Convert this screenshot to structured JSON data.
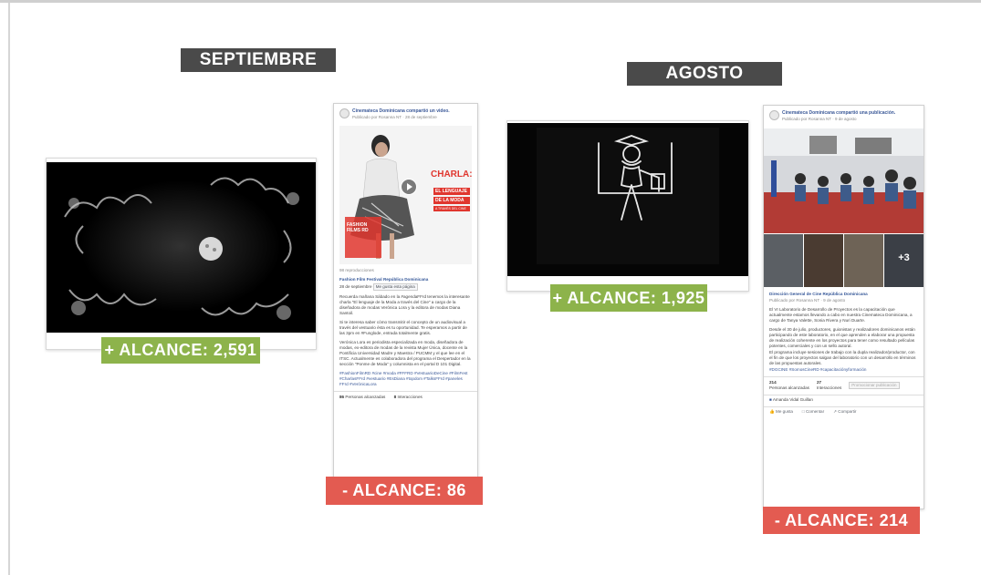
{
  "months": {
    "left": "SEPTIEMBRE",
    "right": "AGOSTO"
  },
  "badges": {
    "sept_video": "+  ALCANCE: 2,591",
    "sept_post": "- ALCANCE: 86",
    "ago_video": "+  ALCANCE: 1,925",
    "ago_post": "- ALCANCE: 214"
  },
  "colors": {
    "positive": "#8db34b",
    "negative": "#e35b51",
    "month_bar": "#4a4a4a"
  },
  "post_sept": {
    "header_line1": "Cinemateca Dominicana compartió un video.",
    "header_line2": "Publicado por Rosanna NT · 28 de septiembre",
    "poster_title": "CHARLA:",
    "poster_sub": [
      "EL LENGUAJE",
      "DE LA MODA",
      "A TRAVÉS DEL CINE"
    ],
    "poster_name": "FASHION FILMS RD",
    "views": "98 reproducciones",
    "page_name": "Fashion Film Festival República Dominicana",
    "page_date": "28 de septiembre",
    "like_page": "Me gusta esta página",
    "p1": "Recuerda mañana Sábado en la #agendaFFrd tenemos la interesante charla \"El lenguaje de la Moda a través del Cine\" a cargo de la diseñadora de modas Verónica Lora y la editora de modas Diana Santoil.",
    "p2": "Si te interesa saber cómo transmitir el concepto de un audiovisual a través del vestuario ésta es tu oportunidad. Te esperamos a partir de las 3pm en #Funglode, entrada totalmente gratis.",
    "p3": "Verónica Lora es periodista especializada en moda, diseñadora de modas, ex-editora de modas de la revista Mujer Única, docente en la Pontificia Universidad Madre y Maestra / PUCMM y el que lee en el ITSC. Actualmente es colaboradora del programa el Despertador en la sección \"Ponme de Moda\" y columnista en el portal D 101 Digital.",
    "tags": "#FashionFilmRD #cine #moda #FFFRD #VestuarioDeCine #FilmFest #CharlasFFrd #vestuario #EsDiana #topdom #TalksFFrd #paneles FFrd #VerónicaLora",
    "stat1_num": "86",
    "stat1_label": "Personas alcanzadas",
    "stat2_num": "8",
    "stat2_label": "Interacciones"
  },
  "post_ago": {
    "header_line1": "Cinemateca Dominicana compartió una publicación.",
    "header_line2": "Publicado por Rosanna NT · 9 de agosto",
    "more_photos": "+3",
    "page_name": "Dirección General de Cine República Dominicana",
    "page_sub": "Publicado por Rosanna NT · 9 de agosto",
    "p1": "El VI Laboratorio de Desarrollo de Proyectos es la capacitación que actualmente estamos llevando a cabo en nuestra Cinemateca Dominicana, a cargo de Tanya Valette, Sonia Rivera y Nuri Duarte.",
    "p2": "Desde el 30 de julio, productores, guionistas y realizadores dominicanos están participando de este laboratorio, en el que aprenden a elaborar una propuesta de realización coherente en los proyectos para tener como resultado películas potentes, comerciales y con un sello autoral.",
    "p3": "El programa incluye sesiones de trabajo con la dupla realizador/productor, con el fin de que los proyectos salgan del laboratorio con un desarrollo en términos de las propuestas autorales.",
    "tags": "#DGCINE #SomosCineRD #capacitaciónyformación",
    "stat1_num": "214",
    "stat1_label": "Personas alcanzadas",
    "stat2_num": "27",
    "stat2_label": "Interacciones",
    "promote": "Promocionar publicación",
    "liker": "Amanda Vidal Guillan",
    "actions": [
      "Me gusta",
      "Comentar",
      "Compartir"
    ]
  }
}
